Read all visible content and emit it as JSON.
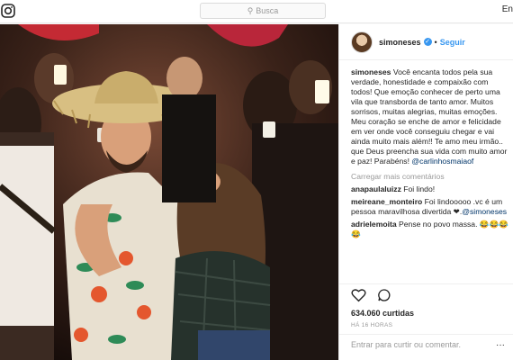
{
  "topbar": {
    "search_placeholder": "Busca",
    "right_text": "En"
  },
  "post": {
    "username": "simoneses",
    "follow_label": "Seguir",
    "dot": "•",
    "caption_user": "simoneses",
    "caption_text": " Você encanta todos pela sua verdade, honestidade e compaixão com todos! Que emoção conhecer de perto uma vila que transborda de tanto amor. Muitos sorrisos, muitas alegrias, muitas emoções. Meu coração se enche de amor e felicidade em ver onde você conseguiu chegar e vai ainda muito mais além!! Te amo meu irmão.. que Deus preencha sua vida com muito amor e paz! Parabéns! ",
    "caption_mention": "@carlinhosmaiaof",
    "load_more": "Carregar mais comentários",
    "comments": [
      {
        "user": "anapaulaluizz",
        "text": " Foi lindo!",
        "mention": ""
      },
      {
        "user": "meireane_monteiro",
        "text": " Foi lindooooo .vc é um pessoa maravilhosa divertida ❤.",
        "mention": "@simoneses"
      },
      {
        "user": "adrielemoita",
        "text": " Pense no povo massa. 😂😂😂😂",
        "mention": ""
      }
    ],
    "likes": "634.060 curtidas",
    "time": "HÁ 16 HORAS",
    "add_comment_placeholder": "Entrar para curtir ou comentar.",
    "more": "···"
  },
  "icons": {
    "logo": "instagram-icon",
    "search": "search-icon",
    "verified": "verified-badge-icon",
    "like": "heart-icon",
    "comment": "comment-icon"
  },
  "colors": {
    "accent": "#3897f0",
    "text": "#262626",
    "muted": "#999999",
    "mention": "#003569"
  }
}
